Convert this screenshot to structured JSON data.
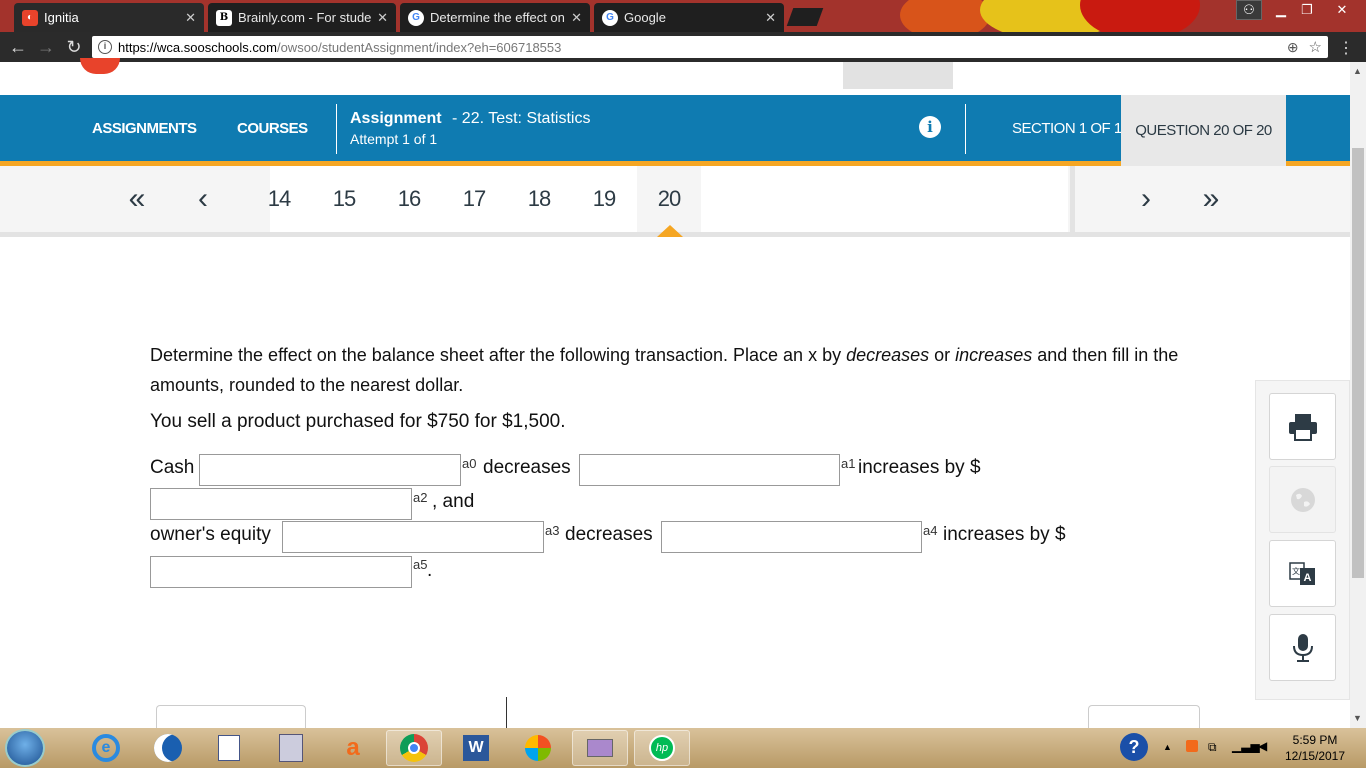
{
  "browser": {
    "tabs": [
      {
        "title": "Ignitia",
        "favicon": "ignitia-icon",
        "active": true
      },
      {
        "title": "Brainly.com - For studen",
        "favicon": "brainly-icon",
        "active": false
      },
      {
        "title": "Determine the effect on",
        "favicon": "google-icon",
        "active": false
      },
      {
        "title": "Google",
        "favicon": "google-icon",
        "active": false
      }
    ],
    "url_host": "https://wca.sooschools.com",
    "url_path": "/owsoo/studentAssignment/index?eh=606718553"
  },
  "nav": {
    "assignments": "ASSIGNMENTS",
    "courses": "COURSES",
    "assignment_label": "Assignment",
    "assignment_name": "- 22. Test: Statistics",
    "attempt": "Attempt 1 of 1",
    "section": "SECTION 1 OF 1",
    "question": "QUESTION 20 OF 20"
  },
  "question_nav": {
    "numbers": [
      "14",
      "15",
      "16",
      "17",
      "18",
      "19",
      "20"
    ],
    "current": "20",
    "first": "«",
    "prev": "‹",
    "next": "›",
    "last": "»"
  },
  "question": {
    "line1_a": "Determine the effect on the balance sheet after the following transaction. Place an x by ",
    "line1_em1": "decreases",
    "line1_b": " or ",
    "line1_em2": "increases",
    "line1_c": " and then fill in the amounts, rounded to the nearest dollar.",
    "scenario": "You sell a product purchased for $750 for $1,500.",
    "cash_label": "Cash",
    "decreases": "decreases",
    "increases_by": "increases by $",
    "and": ", and",
    "owners_equity": "owner's equity",
    "period": ".",
    "fields": {
      "a0": "",
      "a1": "",
      "a2": "",
      "a3": "",
      "a4": "",
      "a5": ""
    },
    "sup": {
      "a0": "a0",
      "a1": "a1",
      "a2": "a2",
      "a3": "a3",
      "a4": "a4",
      "a5": "a5"
    }
  },
  "tools": [
    "print-icon",
    "globe-icon",
    "translate-icon",
    "microphone-icon"
  ],
  "taskbar": {
    "time": "5:59 PM",
    "date": "12/15/2017"
  },
  "colors": {
    "brand_blue": "#0f7bb1",
    "accent_orange": "#f5a623"
  }
}
